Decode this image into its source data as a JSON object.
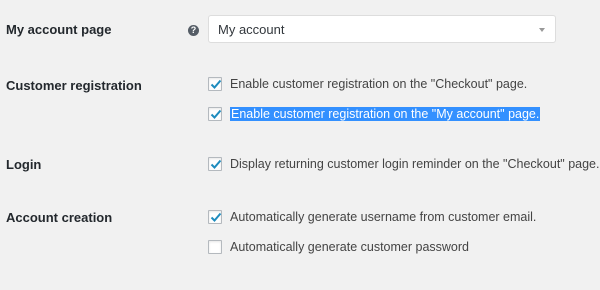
{
  "account_page": {
    "label": "My account page",
    "help_icon": "question-circle-icon",
    "select_value": "My account"
  },
  "customer_registration": {
    "label": "Customer registration",
    "options": [
      {
        "label": "Enable customer registration on the \"Checkout\" page.",
        "checked": true
      },
      {
        "label": "Enable customer registration on the \"My account\" page.",
        "checked": true,
        "selected_text": true
      }
    ]
  },
  "login": {
    "label": "Login",
    "options": [
      {
        "label": "Display returning customer login reminder on the \"Checkout\" page.",
        "checked": true
      }
    ]
  },
  "account_creation": {
    "label": "Account creation",
    "options": [
      {
        "label": "Automatically generate username from customer email.",
        "checked": true
      },
      {
        "label": "Automatically generate customer password",
        "checked": false
      }
    ]
  },
  "colors": {
    "checkmark": "#1e8cbe",
    "selection": "#3390ff"
  }
}
